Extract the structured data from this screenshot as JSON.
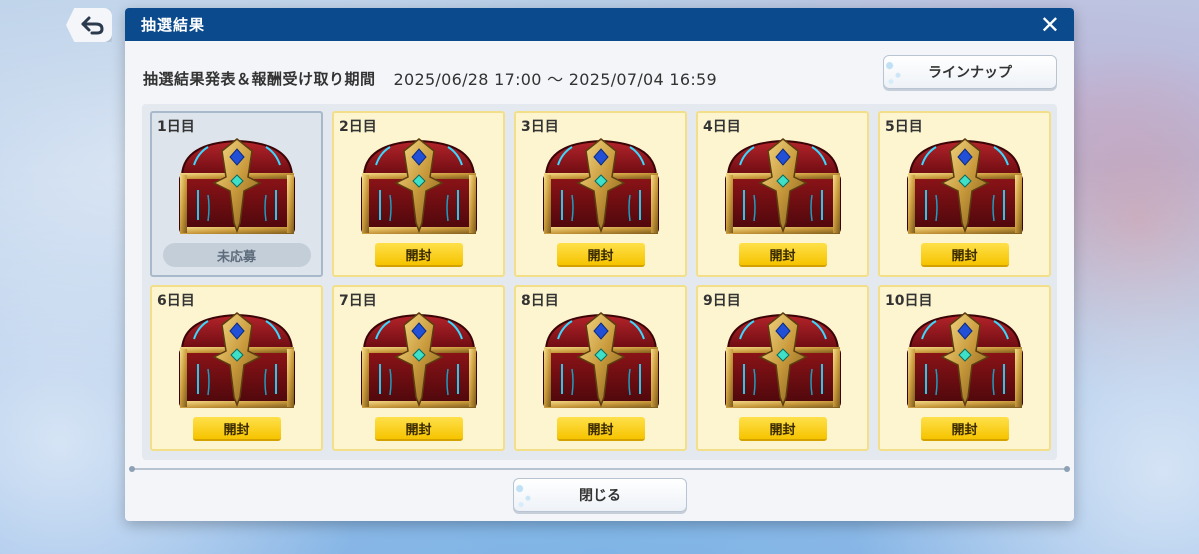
{
  "dialog": {
    "title": "抽選結果",
    "close_icon": "✕",
    "period_label": "抽選結果発表＆報酬受け取り期間",
    "period_value": "2025/06/28 17:00 〜 2025/07/04 16:59",
    "lineup_button": "ラインナップ",
    "close_button": "閉じる"
  },
  "days": [
    {
      "label": "1日目",
      "action": "未応募",
      "state": "unapplied"
    },
    {
      "label": "2日目",
      "action": "開封",
      "state": "open"
    },
    {
      "label": "3日目",
      "action": "開封",
      "state": "open"
    },
    {
      "label": "4日目",
      "action": "開封",
      "state": "open"
    },
    {
      "label": "5日目",
      "action": "開封",
      "state": "open"
    },
    {
      "label": "6日目",
      "action": "開封",
      "state": "open"
    },
    {
      "label": "7日目",
      "action": "開封",
      "state": "open"
    },
    {
      "label": "8日目",
      "action": "開封",
      "state": "open"
    },
    {
      "label": "9日目",
      "action": "開封",
      "state": "open"
    },
    {
      "label": "10日目",
      "action": "開封",
      "state": "open"
    }
  ],
  "colors": {
    "header": "#0b4a8c",
    "cell_open_bg": "#fdf5cf",
    "cell_unapplied_bg": "#dde4ec",
    "open_button": "#f6c400"
  },
  "icons": {
    "back": "back-arrow-icon",
    "chest": "treasure-chest-icon"
  }
}
